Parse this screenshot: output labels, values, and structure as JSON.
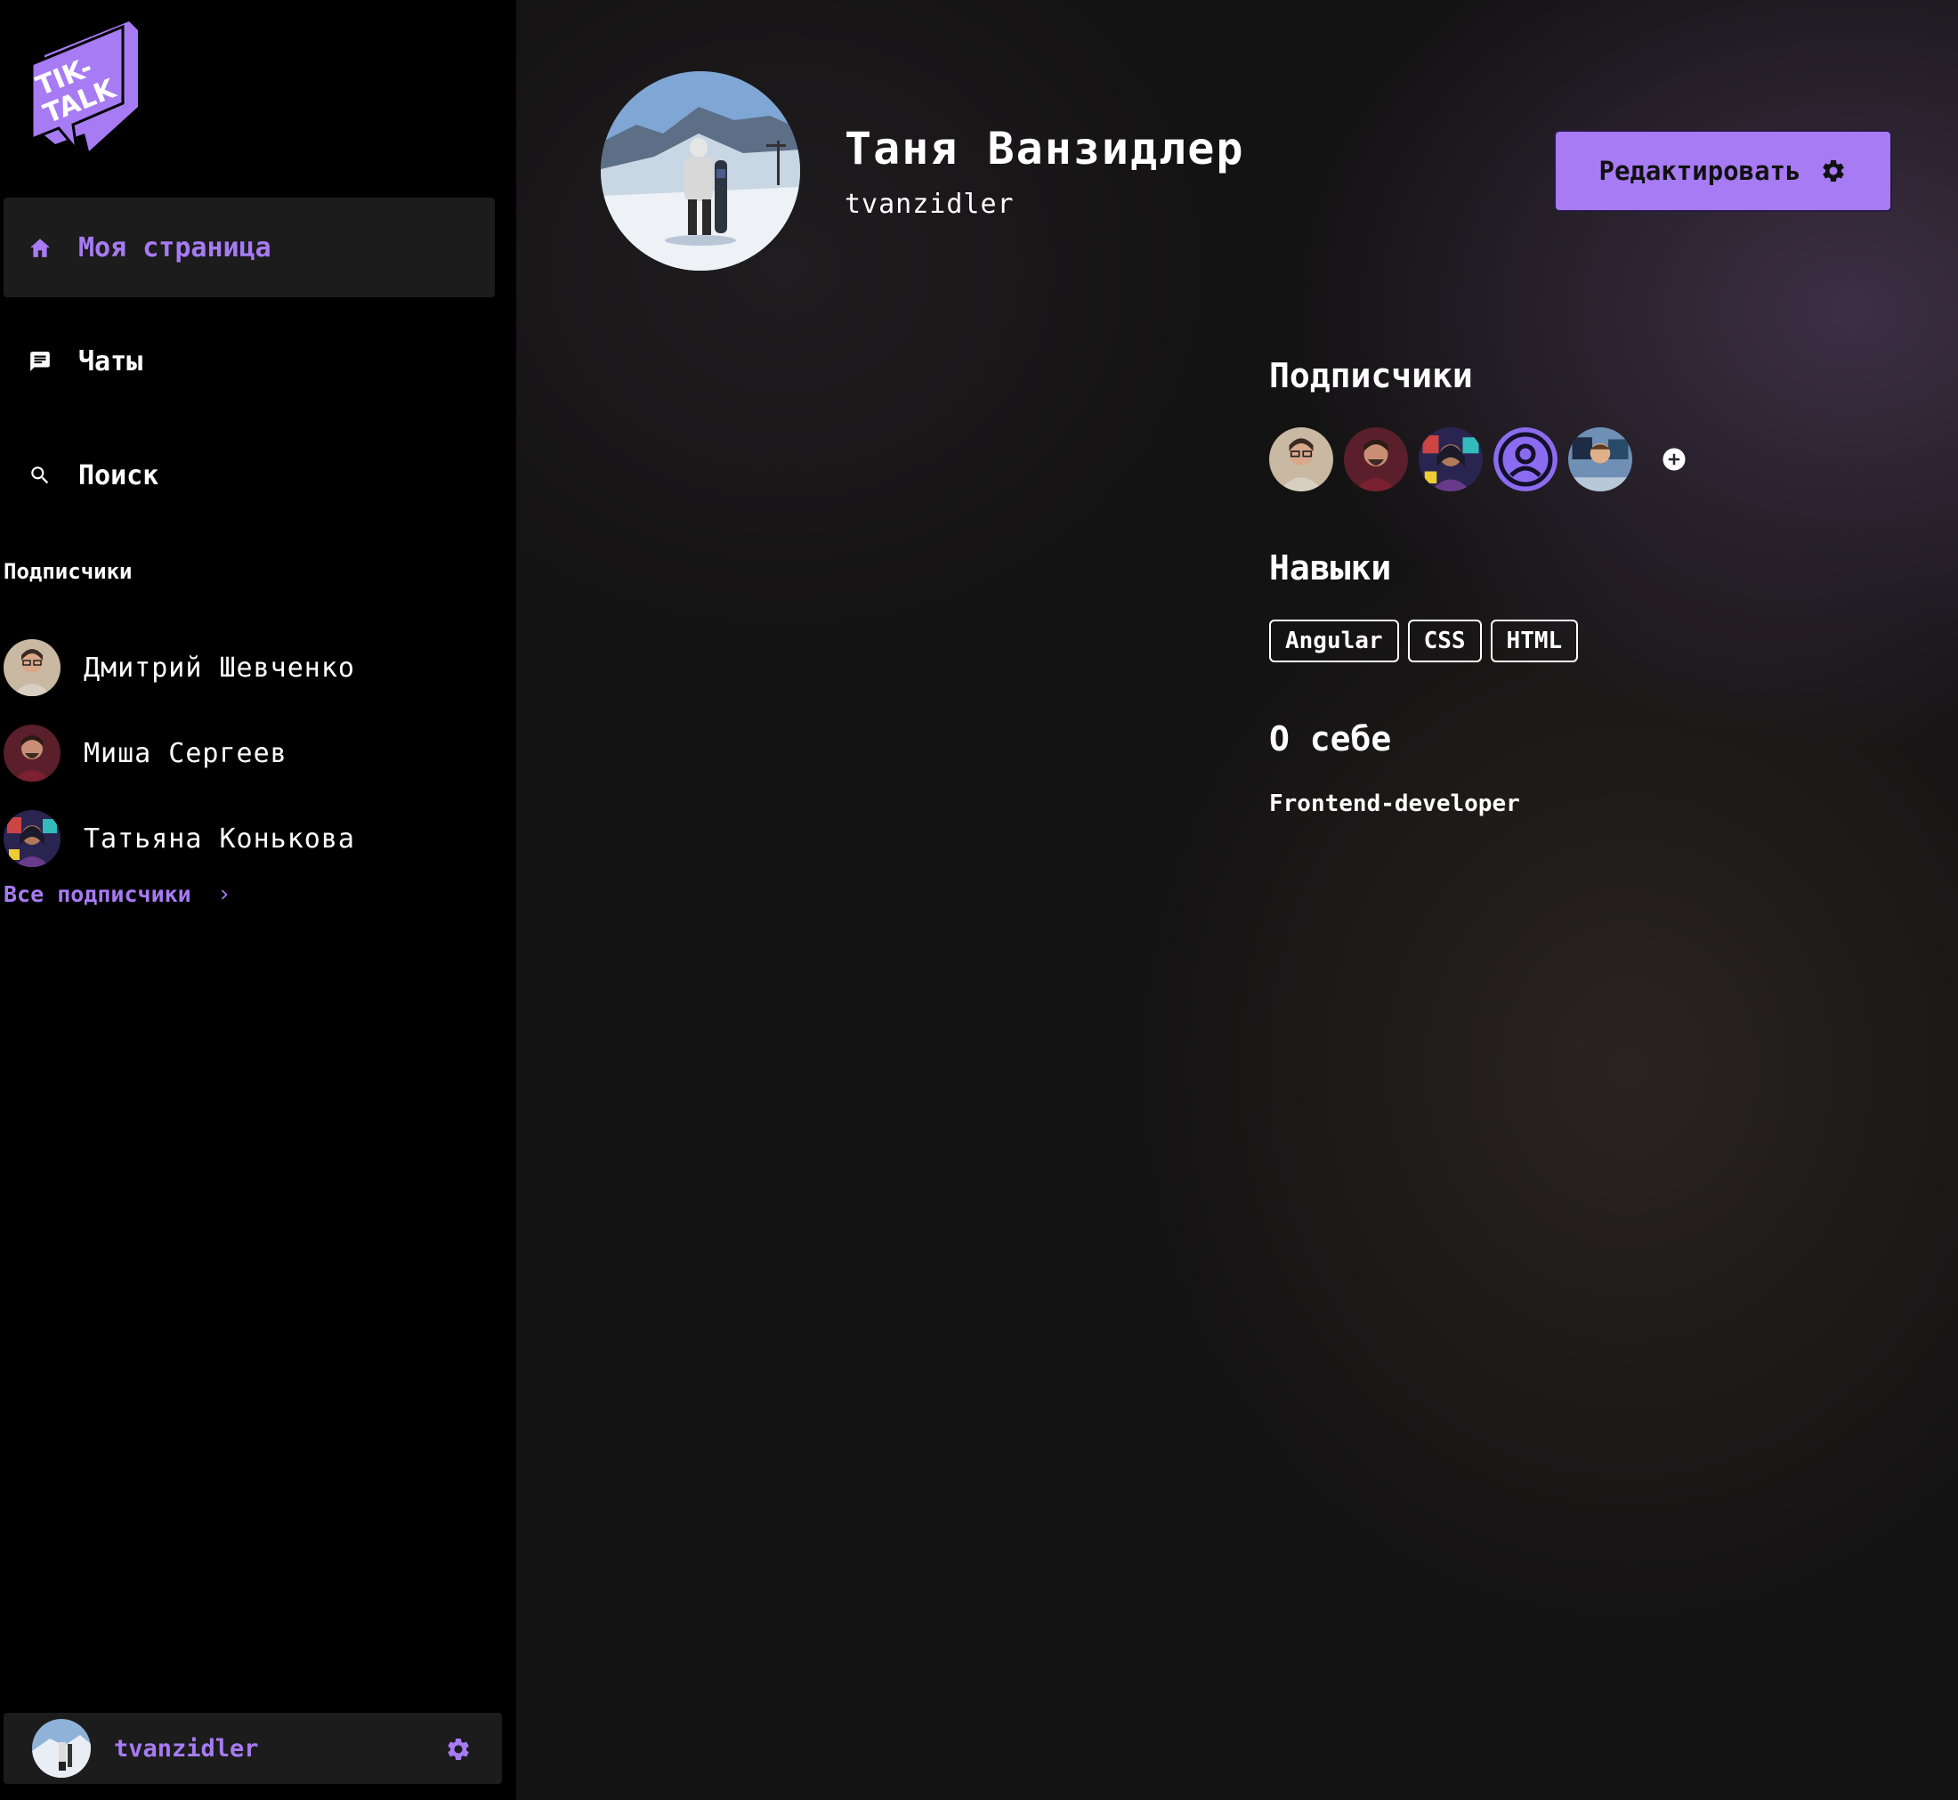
{
  "app": {
    "logo_text": "TIK-TALK"
  },
  "nav": [
    {
      "label": "Моя страница",
      "icon": "home-icon",
      "active": true
    },
    {
      "label": "Чаты",
      "icon": "chat-icon",
      "active": false
    },
    {
      "label": "Поиск",
      "icon": "search-icon",
      "active": false
    }
  ],
  "sidebar": {
    "subscribers_heading": "Подписчики",
    "subscribers": [
      {
        "name": "Дмитрий Шевченко"
      },
      {
        "name": "Миша Сергеев"
      },
      {
        "name": "Татьяна Конькова"
      }
    ],
    "all_subscribers_label": "Все подписчики"
  },
  "me": {
    "username": "tvanzidler"
  },
  "profile": {
    "name": "Таня Ванзидлер",
    "username": "tvanzidler",
    "edit_label": "Редактировать",
    "followers_title": "Подписчики",
    "skills_title": "Навыки",
    "skills": [
      "Angular",
      "CSS",
      "HTML"
    ],
    "about_title": "О себе",
    "about_text": "Frontend-developer"
  },
  "colors": {
    "accent": "#a77bf3",
    "sidebar_bg": "#000000",
    "panel_bg": "#1c1c1c"
  }
}
